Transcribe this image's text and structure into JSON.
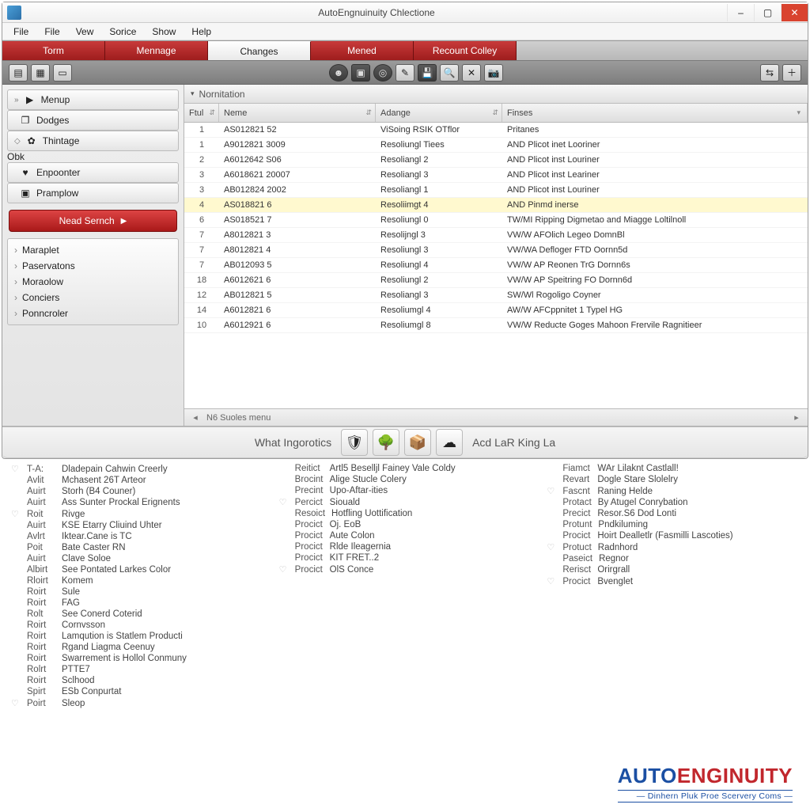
{
  "window": {
    "title": "AutoEngnuinuity Chlectione",
    "controls": {
      "min": "–",
      "max": "▢",
      "close": "✕"
    }
  },
  "menus": [
    "File",
    "File",
    "Vew",
    "Sorice",
    "Show",
    "Help"
  ],
  "redtabs": [
    {
      "label": "Torm",
      "active": false
    },
    {
      "label": "Mennage",
      "active": false
    },
    {
      "label": "Changes",
      "active": true
    },
    {
      "label": "Mened",
      "active": false
    },
    {
      "label": "Recount Colley",
      "active": false
    }
  ],
  "sidebar": {
    "items": [
      {
        "label": "Menup",
        "icon": "▶",
        "chev": "»"
      },
      {
        "label": "Dodges",
        "icon": "❐",
        "chev": ""
      },
      {
        "label": "Thintage",
        "sub": "Obk",
        "icon": "✿",
        "chev": "◇"
      },
      {
        "label": "Enpoonter",
        "icon": "♥",
        "chev": ""
      },
      {
        "label": "Pramplow",
        "icon": "▣",
        "chev": ""
      }
    ],
    "action": {
      "label": "Nead Sernch",
      "play": "▶"
    },
    "tree": [
      "Maraplet",
      "Paservatons",
      "Moraolow",
      "Conciers",
      "Ponncroler"
    ]
  },
  "panel": {
    "title": "Nornitation",
    "tri": "▾"
  },
  "columns": [
    "Ftul",
    "Neme",
    "Adange",
    "Finses"
  ],
  "rows": [
    {
      "n": "1",
      "name": "AS012821 52",
      "ad": "ViSoing RSIK OTflor",
      "fin": "Pritanes"
    },
    {
      "n": "1",
      "name": "A9012821 3009",
      "ad": "Resoliungl Tiees",
      "fin": "AND Plicot inet Looriner"
    },
    {
      "n": "2",
      "name": "A6012642 S06",
      "ad": "Resoliangl 2",
      "fin": "AND Plicot inst Louriner"
    },
    {
      "n": "3",
      "name": "A6018621 20007",
      "ad": "Resoliangl 3",
      "fin": "AND Plicot inst Leariner"
    },
    {
      "n": "3",
      "name": "AB012824 2002",
      "ad": "Resoliangl 1",
      "fin": "AND Plicot inst Louriner",
      "sel": false
    },
    {
      "n": "4",
      "name": "AS018821 6",
      "ad": "Resoliimgt 4",
      "fin": "AND Pinmd inerse",
      "sel": true
    },
    {
      "n": "6",
      "name": "AS018521 7",
      "ad": "Resoliungl 0",
      "fin": "TW/MI Ripping Digmetao and Miagge Loltilnoll"
    },
    {
      "n": "7",
      "name": "A8012821 3",
      "ad": "Resolijngl 3",
      "fin": "VW/W AFOlich Legeo DomnBl"
    },
    {
      "n": "7",
      "name": "A8012821 4",
      "ad": "Resoliungl 3",
      "fin": "VW/WA Defloger FTD Oornn5d"
    },
    {
      "n": "7",
      "name": "AB012093 5",
      "ad": "Resoliungl 4",
      "fin": "VW/W AP Reonen TrG Dornn6s"
    },
    {
      "n": "18",
      "name": "A6012621 6",
      "ad": "Resoliungl 2",
      "fin": "VW/W AP Speitring FO Dornn6d"
    },
    {
      "n": "12",
      "name": "AB012821 5",
      "ad": "Resoliangl 3",
      "fin": "SW/Wl Rogoligo Coyner"
    },
    {
      "n": "14",
      "name": "A6012821 6",
      "ad": "Resoliumgl 4",
      "fin": "AW/W AFCppnitet 1 Typel HG"
    },
    {
      "n": "10",
      "name": "A6012921 6",
      "ad": "Resoliumgl 8",
      "fin": "VW/W Reducte Goges Mahoon Frervile Ragnitieer"
    }
  ],
  "status": {
    "left": "◂",
    "text": "N6 Suoles menu",
    "right": "▸"
  },
  "appbottom": {
    "left": "What Ingorotics",
    "icons": [
      "🛡",
      "🌳",
      "📦",
      "☁"
    ],
    "right": "Acd LaR King La"
  },
  "lower": {
    "col1": [
      {
        "h": "♡",
        "k": "T-A:",
        "v": "Dladepain Cahwin Creerly"
      },
      {
        "h": "",
        "k": "Avlit",
        "v": "Mchasent 26T Arteor"
      },
      {
        "h": "",
        "k": "Auirt",
        "v": "Storh (B4 Couner)"
      },
      {
        "h": "",
        "k": "Auirt",
        "v": "Ass Sunter Prockal Erignents"
      },
      {
        "h": "♡",
        "k": "Roit",
        "v": "Rivge"
      },
      {
        "h": "",
        "k": "Auirt",
        "v": "KSE Etarry Cliuind Uhter"
      },
      {
        "h": "",
        "k": "Avlrt",
        "v": "Iktear.Cane is TC"
      },
      {
        "h": "",
        "k": "Poit",
        "v": "Bate Caster RN"
      },
      {
        "h": "",
        "k": "Auirt",
        "v": "Clave Soloe"
      },
      {
        "h": "",
        "k": "Albirt",
        "v": "See Pontated Larkes Color"
      },
      {
        "h": "",
        "k": "Rloirt",
        "v": "Komem"
      },
      {
        "h": "",
        "k": "Roirt",
        "v": "Sule"
      },
      {
        "h": "",
        "k": "Roirt",
        "v": "FAG"
      },
      {
        "h": "",
        "k": "Rolt",
        "v": "See Conerd Coterid"
      },
      {
        "h": "",
        "k": "Roirt",
        "v": "Cornvsson"
      },
      {
        "h": "",
        "k": "Roirt",
        "v": "Lamqution is Statlem Producti"
      },
      {
        "h": "",
        "k": "Roirt",
        "v": "Rgand Liagma Ceenuy"
      },
      {
        "h": "",
        "k": "Roirt",
        "v": "Swarrement is Hollol Conmuny"
      },
      {
        "h": "",
        "k": "Rolrt",
        "v": "PTTE7"
      },
      {
        "h": "",
        "k": "Roirt",
        "v": "Sclhood"
      },
      {
        "h": "",
        "k": "Spirt",
        "v": "ESb Conpurtat"
      },
      {
        "h": "♡",
        "k": "Poirt",
        "v": "Sleop"
      }
    ],
    "col2": [
      {
        "h": "",
        "k": "Reitict",
        "v": "Artl5 Beselljl Fainey Vale Coldy"
      },
      {
        "h": "",
        "k": "Brocint",
        "v": "Alige Stucle Colery"
      },
      {
        "h": "",
        "k": "Precint",
        "v": "Upo-Aftar-ities"
      },
      {
        "h": "♡",
        "k": "Percict",
        "v": "Siouald"
      },
      {
        "h": "",
        "k": "Resoict",
        "v": "Hotfling Uottification"
      },
      {
        "h": "",
        "k": "Procict",
        "v": "Oj. EoB"
      },
      {
        "h": "",
        "k": "Procict",
        "v": "Aute Colon"
      },
      {
        "h": "",
        "k": "Procict",
        "v": "Rlde Ileagernia"
      },
      {
        "h": "",
        "k": "Procict",
        "v": "KIT FRET..2"
      },
      {
        "h": "♡",
        "k": "Procict",
        "v": "OlS Conce"
      }
    ],
    "col3": [
      {
        "h": "",
        "k": "Fiamct",
        "v": "WAr Lilaknt Castlall!"
      },
      {
        "h": "",
        "k": "Revart",
        "v": "Dogle Stare Slolelry"
      },
      {
        "h": "♡",
        "k": "Fascnt",
        "v": "Raning Helde"
      },
      {
        "h": "",
        "k": "Protact",
        "v": "By Atugel Conrybation"
      },
      {
        "h": "",
        "k": "Precict",
        "v": "Resor.S6 Dod Lonti"
      },
      {
        "h": "",
        "k": "Protunt",
        "v": "Pndkiluming"
      },
      {
        "h": "",
        "k": "Procict",
        "v": "Hoirt Dealletlr (Fasmilli Lascoties)"
      },
      {
        "h": "♡",
        "k": "Protuct",
        "v": "Radnhord"
      },
      {
        "h": "",
        "k": "Paseict",
        "v": "Regnor"
      },
      {
        "h": "",
        "k": "Rerisct",
        "v": "Orirgrall"
      },
      {
        "h": "♡",
        "k": "Procict",
        "v": "Bvenglet"
      }
    ]
  },
  "brand": {
    "a": "AUTO",
    "b": "ENGINUITY",
    "tag": "— Dinhern Pluk Proe Scervery Coms —"
  }
}
